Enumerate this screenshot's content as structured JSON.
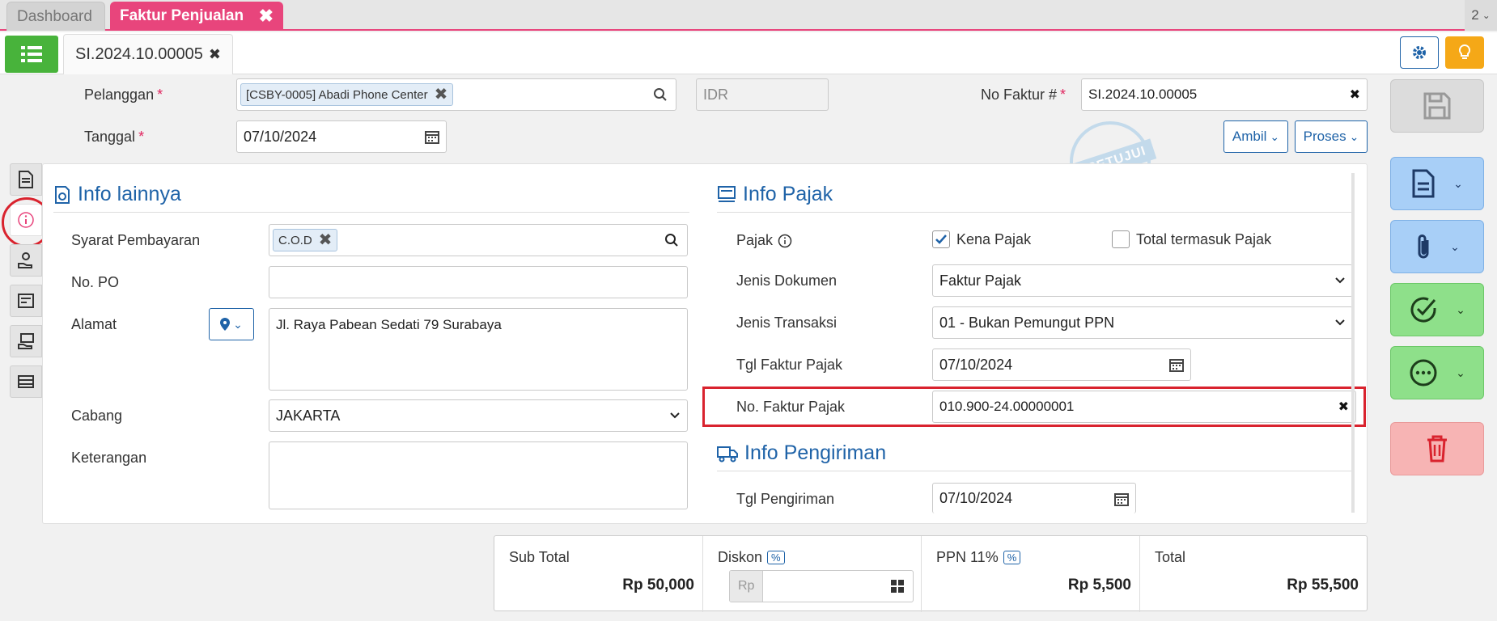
{
  "tabs": {
    "dashboard": "Dashboard",
    "active": "Faktur Penjualan",
    "count": "2"
  },
  "doc_tab": "SI.2024.10.00005",
  "header": {
    "pelanggan_label": "Pelanggan",
    "pelanggan_value": "[CSBY-0005] Abadi Phone Center",
    "currency": "IDR",
    "no_faktur_label": "No Faktur #",
    "no_faktur_value": "SI.2024.10.00005",
    "tanggal_label": "Tanggal",
    "tanggal_value": "07/10/2024",
    "ambil_label": "Ambil",
    "proses_label": "Proses",
    "stamp": "DISETUJUI"
  },
  "info_lainnya": {
    "title": "Info lainnya",
    "syarat_label": "Syarat Pembayaran",
    "syarat_value": "C.O.D",
    "po_label": "No. PO",
    "po_value": "",
    "alamat_label": "Alamat",
    "alamat_value": "Jl. Raya Pabean Sedati 79 Surabaya",
    "cabang_label": "Cabang",
    "cabang_value": "JAKARTA",
    "keterangan_label": "Keterangan",
    "keterangan_value": ""
  },
  "info_pajak": {
    "title": "Info Pajak",
    "pajak_label": "Pajak",
    "kena_pajak_label": "Kena Pajak",
    "kena_pajak_checked": true,
    "termasuk_label": "Total termasuk Pajak",
    "termasuk_checked": false,
    "jenis_dok_label": "Jenis Dokumen",
    "jenis_dok_value": "Faktur Pajak",
    "jenis_trx_label": "Jenis Transaksi",
    "jenis_trx_value": "01 - Bukan Pemungut PPN",
    "tgl_faktur_label": "Tgl Faktur Pajak",
    "tgl_faktur_value": "07/10/2024",
    "no_faktur_pajak_label": "No. Faktur Pajak",
    "no_faktur_pajak_value": "010.900-24.00000001"
  },
  "info_pengiriman": {
    "title": "Info Pengiriman",
    "tgl_label": "Tgl Pengiriman",
    "tgl_value": "07/10/2024"
  },
  "totals": {
    "subtotal_label": "Sub Total",
    "subtotal_value": "Rp 50,000",
    "diskon_label": "Diskon",
    "diskon_prefix": "Rp",
    "ppn_label": "PPN 11%",
    "ppn_value": "Rp 5,500",
    "total_label": "Total",
    "total_value": "Rp 55,500",
    "pct_symbol": "%"
  },
  "colors": {
    "accent": "#e8457c",
    "primary": "#1f63a8",
    "green": "#48b33b",
    "highlight": "#d9232e"
  }
}
